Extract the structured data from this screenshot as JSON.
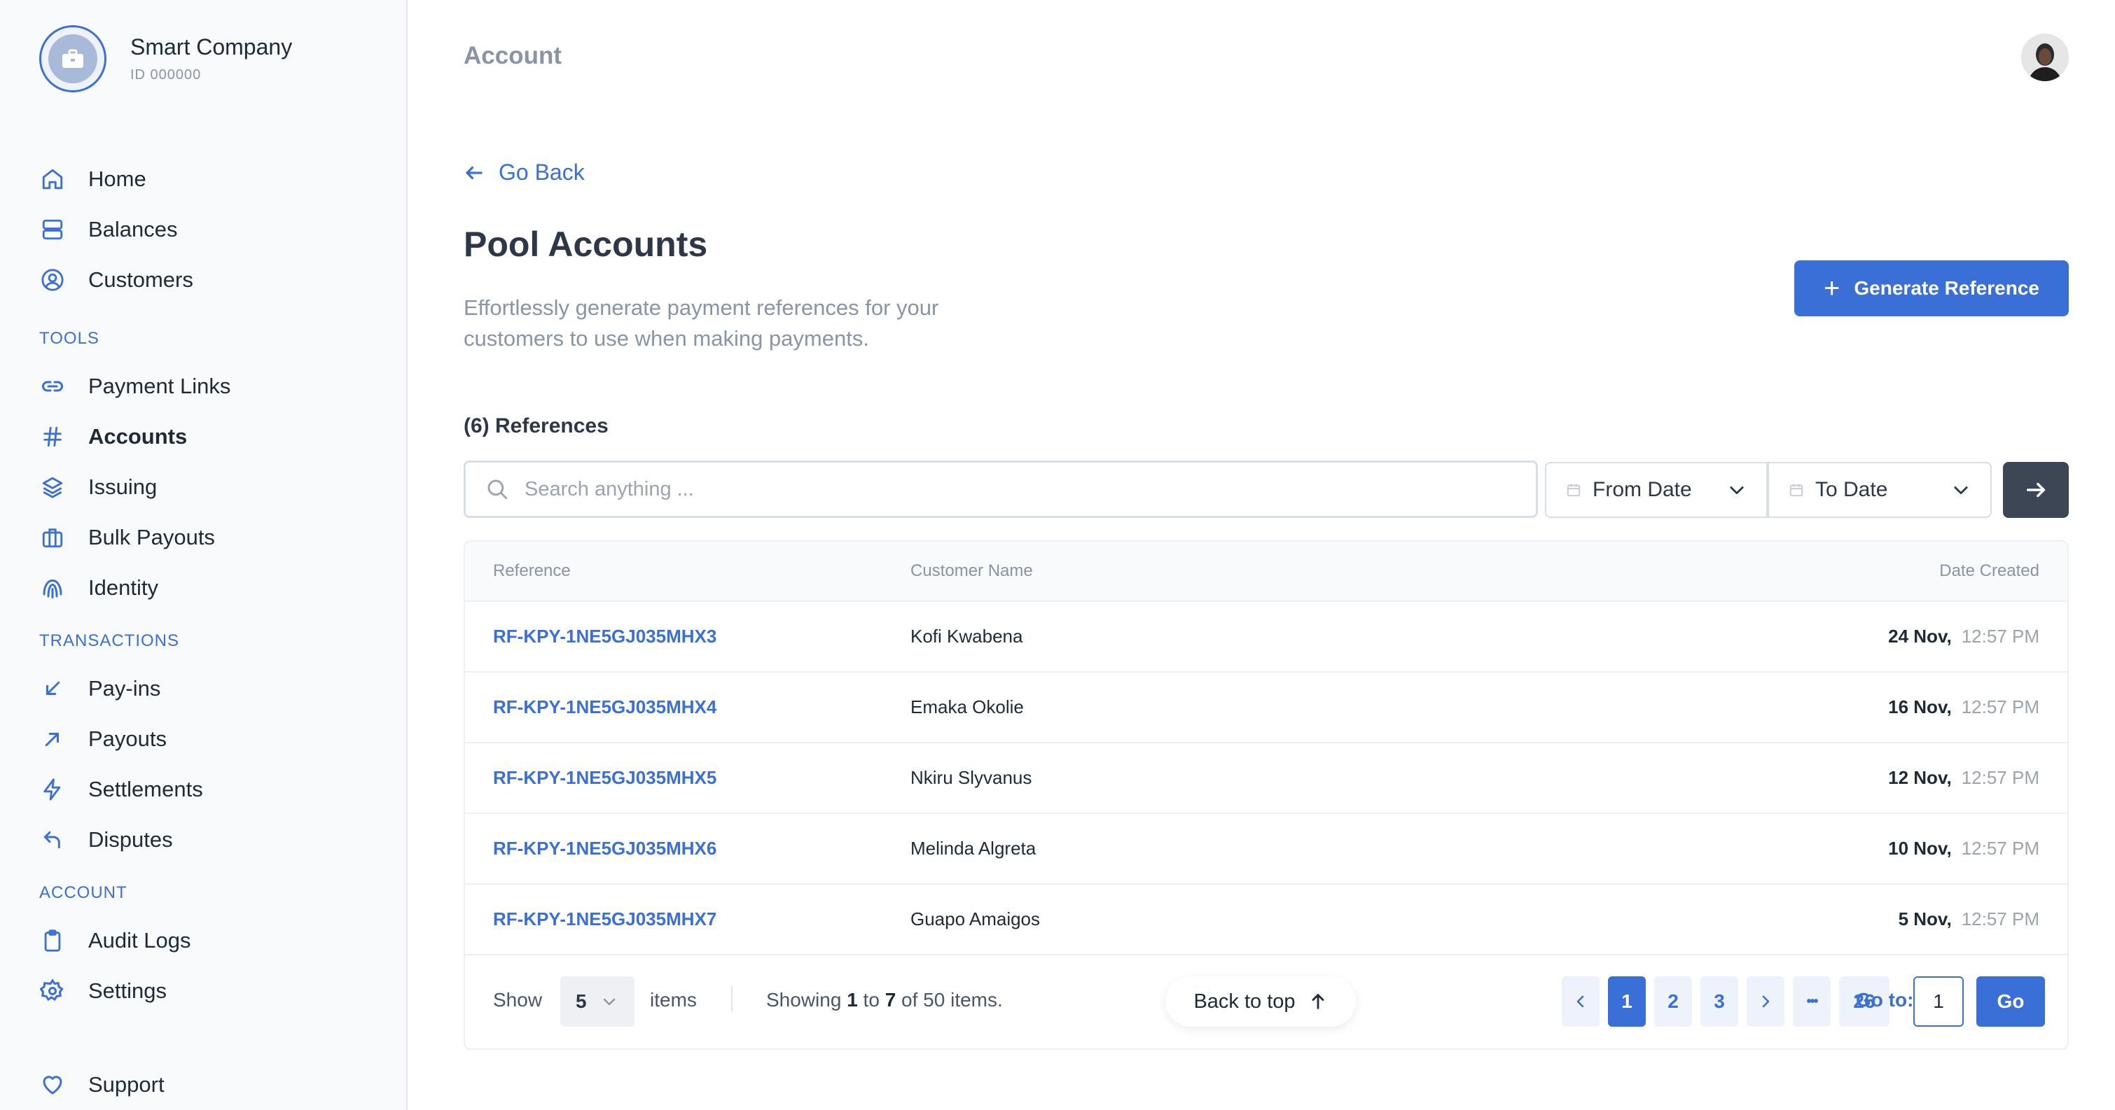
{
  "company": {
    "name": "Smart Company",
    "id": "ID  000000"
  },
  "sidebar": {
    "main_items": [
      {
        "label": "Home",
        "icon": "home-icon"
      },
      {
        "label": "Balances",
        "icon": "balances-icon"
      },
      {
        "label": "Customers",
        "icon": "customers-icon"
      }
    ],
    "tools_label": "TOOLS",
    "tools_items": [
      {
        "label": "Payment Links",
        "icon": "link-icon"
      },
      {
        "label": "Accounts",
        "icon": "hash-icon"
      },
      {
        "label": "Issuing",
        "icon": "layers-icon"
      },
      {
        "label": "Bulk Payouts",
        "icon": "briefcase-icon"
      },
      {
        "label": "Identity",
        "icon": "fingerprint-icon"
      }
    ],
    "transactions_label": "TRANSACTIONS",
    "transactions_items": [
      {
        "label": "Pay-ins",
        "icon": "arrow-down-left-icon"
      },
      {
        "label": "Payouts",
        "icon": "arrow-up-right-icon"
      },
      {
        "label": "Settlements",
        "icon": "lightning-icon"
      },
      {
        "label": "Disputes",
        "icon": "reply-icon"
      }
    ],
    "account_label": "ACCOUNT",
    "account_items": [
      {
        "label": "Audit Logs",
        "icon": "clipboard-icon"
      },
      {
        "label": "Settings",
        "icon": "gear-icon"
      }
    ],
    "support_label": "Support"
  },
  "header": {
    "title": "Account"
  },
  "page": {
    "go_back": "Go Back",
    "title": "Pool Accounts",
    "description": "Effortlessly generate payment references for your customers to use when making payments.",
    "generate_button": "Generate Reference",
    "references_count": "(6) References"
  },
  "filters": {
    "search_placeholder": "Search anything ...",
    "from_date": "From Date",
    "to_date": "To Date"
  },
  "table": {
    "columns": {
      "reference": "Reference",
      "customer": "Customer Name",
      "date": "Date Created"
    },
    "rows": [
      {
        "reference": "RF-KPY-1NE5GJ035MHX3",
        "customer": "Kofi Kwabena",
        "date": "24 Nov,",
        "time": "12:57 PM"
      },
      {
        "reference": "RF-KPY-1NE5GJ035MHX4",
        "customer": "Emaka Okolie",
        "date": "16 Nov,",
        "time": "12:57 PM"
      },
      {
        "reference": "RF-KPY-1NE5GJ035MHX5",
        "customer": "Nkiru Slyvanus",
        "date": "12 Nov,",
        "time": "12:57 PM"
      },
      {
        "reference": "RF-KPY-1NE5GJ035MHX6",
        "customer": "Melinda Algreta",
        "date": "10 Nov,",
        "time": "12:57 PM"
      },
      {
        "reference": "RF-KPY-1NE5GJ035MHX7",
        "customer": "Guapo Amaigos",
        "date": "5 Nov,",
        "time": "12:57 PM"
      }
    ]
  },
  "pagination": {
    "show_label": "Show",
    "page_size": "5",
    "items_label": "items",
    "showing_prefix": "Showing",
    "showing_from": "1",
    "showing_to_word": "to",
    "showing_to": "7",
    "showing_suffix": "of 50 items.",
    "back_to_top": "Back to top",
    "pages": [
      "1",
      "2",
      "3"
    ],
    "ellipsis": "•••",
    "last_page": "26",
    "goto_label": "Go to:",
    "goto_value": "1",
    "go_button": "Go"
  },
  "colors": {
    "accent": "#3b6fd8",
    "dark_button": "#3d4654",
    "muted_text": "#8a94a6"
  }
}
